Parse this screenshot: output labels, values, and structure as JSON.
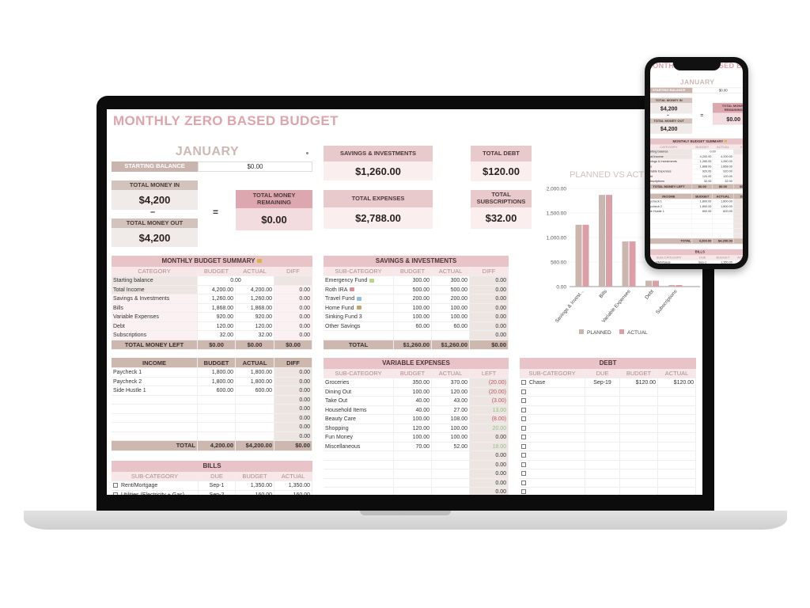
{
  "title": "MONTHLY ZERO BASED BUDGET",
  "month": "JANUARY",
  "month_dropdown_icon": "dropdown-arrow-icon",
  "starting_balance": {
    "label": "STARTING BALANCE",
    "value": "$0.00"
  },
  "total_in": {
    "label": "TOTAL MONEY IN",
    "value": "$4,200"
  },
  "minus": "–",
  "equals": "=",
  "total_out": {
    "label": "TOTAL MONEY OUT",
    "value": "$4,200"
  },
  "remaining": {
    "label": "TOTAL MONEY REMAINING",
    "value": "$0.00"
  },
  "cards": {
    "savings": {
      "label": "SAVINGS & INVESTMENTS",
      "value": "$1,260.00"
    },
    "expenses": {
      "label": "TOTAL EXPENSES",
      "value": "$2,788.00"
    },
    "debt": {
      "label": "TOTAL DEBT",
      "value": "$120.00"
    },
    "subscriptions": {
      "label": "TOTAL SUBSCRIPTIONS",
      "value": "$32.00"
    }
  },
  "summary": {
    "title": "MONTHLY BUDGET SUMMARY",
    "title_icon": "money-bag-icon",
    "headers": [
      "CATEGORY",
      "BUDGET",
      "ACTUAL",
      "DIFF"
    ],
    "starting_row": [
      "Starting balance",
      "0.00"
    ],
    "rows": [
      [
        "Total Income",
        "4,200.00",
        "4,200.00",
        "0.00"
      ],
      [
        "Savings & Investments",
        "1,260.00",
        "1,260.00",
        "0.00"
      ],
      [
        "Bills",
        "1,868.00",
        "1,868.00",
        "0.00"
      ],
      [
        "Variable Expenses",
        "920.00",
        "920.00",
        "0.00"
      ],
      [
        "Debt",
        "120.00",
        "120.00",
        "0.00"
      ],
      [
        "Subscriptions",
        "32.00",
        "32.00",
        "0.00"
      ]
    ],
    "total": [
      "TOTAL MONEY LEFT",
      "$0.00",
      "$0.00",
      "$0.00"
    ]
  },
  "savings": {
    "title": "SAVINGS & INVESTMENTS",
    "headers": [
      "SUB-CATEGORY",
      "BUDGET",
      "ACTUAL",
      "DIFF"
    ],
    "rows": [
      [
        "Emergency Fund",
        "300.00",
        "300.00",
        "0.00"
      ],
      [
        "Roth IRA",
        "500.00",
        "500.00",
        "0.00"
      ],
      [
        "Travel Fund",
        "200.00",
        "200.00",
        "0.00"
      ],
      [
        "Home Fund",
        "100.00",
        "100.00",
        "0.00"
      ],
      [
        "Sinking Fund 3",
        "100.00",
        "100.00",
        "0.00"
      ],
      [
        "Other Savings",
        "60.00",
        "60.00",
        "0.00"
      ],
      [
        "",
        "",
        "",
        "0.00"
      ]
    ],
    "row_icons": [
      "money-icon",
      "chart-up-icon",
      "airplane-icon",
      "house-icon",
      "",
      ""
    ],
    "total": [
      "TOTAL",
      "$1,260.00",
      "$1,260.00",
      "$0.00"
    ]
  },
  "income": {
    "headers": [
      "INCOME",
      "BUDGET",
      "ACTUAL",
      "DIFF"
    ],
    "rows": [
      [
        "Paycheck 1",
        "1,800.00",
        "1,800.00",
        "0.00"
      ],
      [
        "Paycheck 2",
        "1,800.00",
        "1,800.00",
        "0.00"
      ],
      [
        "Side Hustle 1",
        "600.00",
        "600.00",
        "0.00"
      ],
      [
        "",
        "",
        "",
        "0.00"
      ],
      [
        "",
        "",
        "",
        "0.00"
      ],
      [
        "",
        "",
        "",
        "0.00"
      ],
      [
        "",
        "",
        "",
        "0.00"
      ],
      [
        "",
        "",
        "",
        "0.00"
      ]
    ],
    "total": [
      "TOTAL",
      "4,200.00",
      "$4,200.00",
      "$0.00"
    ]
  },
  "bills": {
    "title": "BILLS",
    "headers": [
      "SUB-CATEGORY",
      "DUE",
      "BUDGET",
      "ACTUAL"
    ],
    "rows": [
      [
        "Rent/Mortgage",
        "Sep-1",
        "1,350.00",
        "1,350.00"
      ],
      [
        "Utilities (Electricity + Gas)",
        "Sep-2",
        "160.00",
        "160.00"
      ]
    ]
  },
  "variable": {
    "title": "VARIABLE EXPENSES",
    "headers": [
      "SUB-CATEGORY",
      "BUDGET",
      "ACTUAL",
      "LEFT"
    ],
    "rows": [
      [
        "Groceries",
        "350.00",
        "370.00",
        "(20.00)"
      ],
      [
        "Dining Out",
        "100.00",
        "120.00",
        "(20.00)"
      ],
      [
        "Take Out",
        "40.00",
        "43.00",
        "(3.00)"
      ],
      [
        "Household Items",
        "40.00",
        "27.00",
        "13.00"
      ],
      [
        "Beauty Care",
        "100.00",
        "108.00",
        "(8.00)"
      ],
      [
        "Shopping",
        "120.00",
        "100.00",
        "20.00"
      ],
      [
        "Fun Money",
        "100.00",
        "100.00",
        "0.00"
      ],
      [
        "Miscellaneous",
        "70.00",
        "52.00",
        "18.00"
      ],
      [
        "",
        "",
        "",
        "0.00"
      ],
      [
        "",
        "",
        "",
        "0.00"
      ],
      [
        "",
        "",
        "",
        "0.00"
      ],
      [
        "",
        "",
        "",
        "0.00"
      ],
      [
        "",
        "",
        "",
        "0.00"
      ]
    ],
    "negative_color": "#c4525d",
    "positive_color": "#93c283"
  },
  "debt": {
    "title": "DEBT",
    "headers": [
      "SUB-CATEGORY",
      "DUE",
      "BUDGET",
      "ACTUAL"
    ],
    "rows": [
      [
        "Chase",
        "Sep-19",
        "$120.00",
        "$120.00"
      ],
      [
        "",
        "",
        "",
        ""
      ],
      [
        "",
        "",
        "",
        ""
      ],
      [
        "",
        "",
        "",
        ""
      ],
      [
        "",
        "",
        "",
        ""
      ],
      [
        "",
        "",
        "",
        ""
      ],
      [
        "",
        "",
        "",
        ""
      ],
      [
        "",
        "",
        "",
        ""
      ],
      [
        "",
        "",
        "",
        ""
      ],
      [
        "",
        "",
        "",
        ""
      ],
      [
        "",
        "",
        "",
        ""
      ],
      [
        "",
        "",
        "",
        ""
      ],
      [
        "",
        "",
        "",
        ""
      ]
    ]
  },
  "chart_data": {
    "type": "bar",
    "title": "PLANNED VS ACTUAL",
    "categories": [
      "Savings & Invest...",
      "Bills",
      "Variable Expenses",
      "Debt",
      "Subscriptions"
    ],
    "series": [
      {
        "name": "PLANNED",
        "values": [
          1260,
          1868,
          920,
          120,
          32
        ],
        "color": "#c9b6ae"
      },
      {
        "name": "ACTUAL",
        "values": [
          1260,
          1868,
          920,
          120,
          32
        ],
        "color": "#dd9fa7"
      }
    ],
    "yticks": [
      "0.00",
      "500.00",
      "1,000.00",
      "1,500.00",
      "2,000.00"
    ],
    "ylim": [
      0,
      2000
    ],
    "grid": true,
    "legend": "bottom"
  },
  "colors": {
    "title": "#dca4ac",
    "tan": "#cdb8b0",
    "pink_header": "#e8c4c8",
    "light_pink": "#fbeeef"
  }
}
